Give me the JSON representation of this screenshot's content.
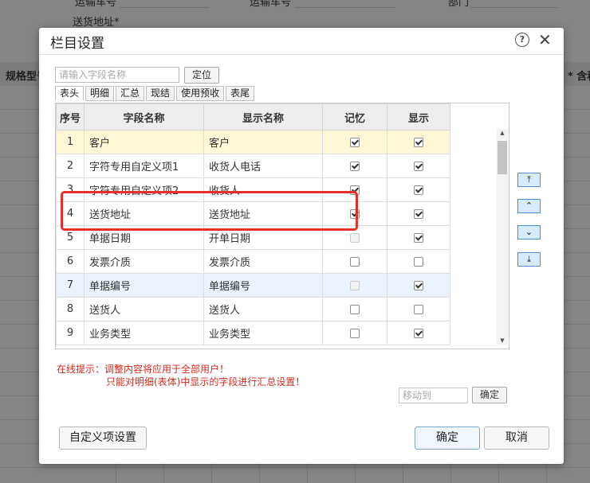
{
  "background": {
    "labels": [
      "运输车号",
      "运输车号",
      "部门",
      "送货地址*",
      "规格型号",
      "* 含税"
    ]
  },
  "dialog": {
    "title": "栏目设置",
    "search_placeholder": "请输入字段名称",
    "locate_label": "定位",
    "tabs": [
      "表头",
      "明细",
      "汇总",
      "现结",
      "使用预收",
      "表尾"
    ],
    "active_tab": "表头",
    "columns": [
      "序号",
      "字段名称",
      "显示名称",
      "记忆",
      "显示"
    ],
    "rows": [
      {
        "no": "1",
        "field": "客户",
        "display": "客户",
        "memory": true,
        "memory_disabled": false,
        "show": true
      },
      {
        "no": "2",
        "field": "字符专用自定义项1",
        "display": "收货人电话",
        "memory": true,
        "memory_disabled": false,
        "show": true
      },
      {
        "no": "3",
        "field": "字符专用自定义项2",
        "display": "收货人",
        "memory": true,
        "memory_disabled": false,
        "show": true
      },
      {
        "no": "4",
        "field": "送货地址",
        "display": "送货地址",
        "memory": true,
        "memory_disabled": false,
        "show": true
      },
      {
        "no": "5",
        "field": "单据日期",
        "display": "开单日期",
        "memory": false,
        "memory_disabled": true,
        "show": true
      },
      {
        "no": "6",
        "field": "发票介质",
        "display": "发票介质",
        "memory": false,
        "memory_disabled": false,
        "show": false
      },
      {
        "no": "7",
        "field": "单据编号",
        "display": "单据编号",
        "memory": false,
        "memory_disabled": true,
        "show": true
      },
      {
        "no": "8",
        "field": "送货人",
        "display": "送货人",
        "memory": false,
        "memory_disabled": false,
        "show": false
      },
      {
        "no": "9",
        "field": "业务类型",
        "display": "业务类型",
        "memory": false,
        "memory_disabled": false,
        "show": true
      }
    ],
    "move_buttons": [
      "⤒",
      "⌃",
      "⌄",
      "⤓"
    ],
    "notice_line1": "在线提示：调整内容将应用于全部用户！",
    "notice_line2": "只能对明细(表体)中显示的字段进行汇总设置！",
    "moveto_placeholder": "移动到",
    "moveto_confirm": "确定",
    "custom_button": "自定义项设置",
    "ok_button": "确定",
    "cancel_button": "取消",
    "colors": {
      "highlight": "#e3302a",
      "notice": "#d12a1e",
      "selected_row": "#e9f2fd",
      "first_row": "#fff7d6"
    }
  }
}
